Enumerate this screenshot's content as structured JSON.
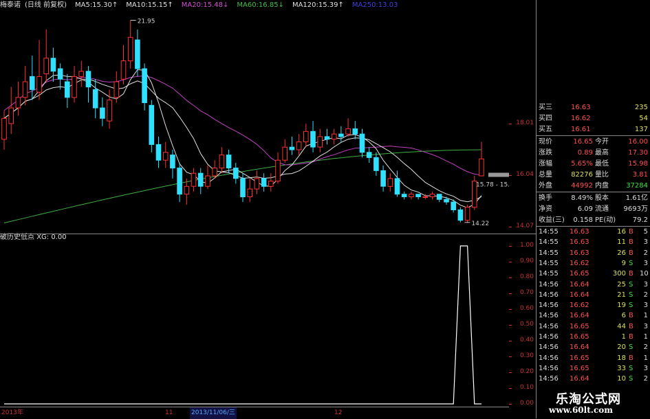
{
  "header": {
    "stock_name": "梅泰诺",
    "period": "(日线 前复权)",
    "mas": [
      {
        "label": "MA5:",
        "value": "15.30",
        "arrow": "↑",
        "color": "#e0e0e0"
      },
      {
        "label": "MA10:",
        "value": "15.15",
        "arrow": "↑",
        "color": "#e0e0e0"
      },
      {
        "label": "MA20:",
        "value": "15.48",
        "arrow": "↓",
        "color": "#d050d0"
      },
      {
        "label": "MA60:",
        "value": "16.85",
        "arrow": "↓",
        "color": "#40c040"
      },
      {
        "label": "MA120:",
        "value": "15.39",
        "arrow": "↑",
        "color": "#e0e0e0"
      },
      {
        "label": "MA250:",
        "value": "13.03",
        "arrow": "",
        "color": "#4040e0"
      }
    ]
  },
  "main_chart": {
    "price_ticks": [
      "18.01",
      "16.04",
      "14.07"
    ],
    "annotations": {
      "high": "21.95",
      "low": "14.22",
      "last_range": "15.78 - 15."
    },
    "colors": {
      "up": "#ff3030",
      "down": "#30e0ff",
      "ma5": "#e0e0e0",
      "ma10": "#e0e0e0",
      "ma20": "#c040c0",
      "ma60": "#40b040",
      "ma250": "#5050e0"
    }
  },
  "indicator": {
    "title": "破历史低点",
    "series_label": "XG: 0.00",
    "ticks": [
      "1.00",
      "0.90",
      "0.80",
      "0.70",
      "0.60",
      "0.50",
      "0.40",
      "0.30",
      "0.20",
      "0.10",
      "0.00"
    ],
    "values": [
      0,
      0,
      0,
      0,
      0,
      0,
      0,
      0,
      0,
      0,
      0,
      0,
      0,
      0,
      0,
      0,
      0,
      0,
      0,
      0,
      0,
      0,
      0,
      0,
      0,
      0,
      0,
      0,
      0,
      0,
      0,
      0,
      0,
      0,
      0,
      0,
      0,
      0,
      0,
      0,
      0,
      0,
      0,
      0,
      0,
      0,
      0,
      0,
      0,
      0,
      0,
      0,
      0,
      0,
      0,
      0,
      0,
      0,
      0,
      0,
      0,
      0,
      0,
      0,
      0,
      1,
      1,
      0,
      0
    ]
  },
  "x_axis": {
    "ticks": [
      {
        "label": "2013年",
        "selected": false
      },
      {
        "label": "11",
        "selected": false
      },
      {
        "label": "2013/11/06/三",
        "selected": true
      },
      {
        "label": "12",
        "selected": false
      }
    ]
  },
  "quote_panel": {
    "bids": [
      {
        "name": "买三",
        "price": "16.63",
        "vol": "235"
      },
      {
        "name": "买四",
        "price": "16.62",
        "vol": "54"
      },
      {
        "name": "买五",
        "price": "16.61",
        "vol": "137"
      }
    ],
    "stats": [
      {
        "l1": "现价",
        "v1": "16.65",
        "l2": "今开",
        "v2": "16.00",
        "c1": "#ff5050",
        "c2": "#ff5050"
      },
      {
        "l1": "涨跌",
        "v1": "0.89",
        "l2": "最高",
        "v2": "17.30",
        "c1": "#ff5050",
        "c2": "#ff5050"
      },
      {
        "l1": "涨幅",
        "v1": "5.65%",
        "l2": "最低",
        "v2": "15.98",
        "c1": "#ff5050",
        "c2": "#ff5050"
      },
      {
        "l1": "总量",
        "v1": "82276",
        "l2": "量比",
        "v2": "3.81",
        "c1": "#e0e060",
        "c2": "#ff5050"
      },
      {
        "l1": "外盘",
        "v1": "44992",
        "l2": "内盘",
        "v2": "37284",
        "c1": "#ff5050",
        "c2": "#40e040"
      }
    ],
    "stats2": [
      {
        "l1": "换手",
        "v1": "8.49%",
        "l2": "股本",
        "v2": "1.61亿"
      },
      {
        "l1": "净资",
        "v1": "6.09",
        "l2": "流通",
        "v2": "9693万"
      },
      {
        "l1": "收益(三)",
        "v1": "0.158",
        "l2": "PE(动)",
        "v2": "79.2"
      }
    ],
    "ticks": [
      {
        "t": "14:55",
        "p": "16.63",
        "v": "16",
        "bs": "B",
        "n": "5"
      },
      {
        "t": "14:55",
        "p": "16.63",
        "v": "11",
        "bs": "B",
        "n": "3"
      },
      {
        "t": "14:55",
        "p": "16.63",
        "v": "26",
        "bs": "B",
        "n": "2"
      },
      {
        "t": "14:55",
        "p": "16.62",
        "v": "9",
        "bs": "S",
        "n": "3"
      },
      {
        "t": "14:55",
        "p": "16.65",
        "v": "300",
        "bs": "B",
        "n": "10"
      },
      {
        "t": "14:56",
        "p": "16.64",
        "v": "25",
        "bs": "S",
        "n": "3"
      },
      {
        "t": "14:56",
        "p": "16.64",
        "v": "21",
        "bs": "S",
        "n": "2"
      },
      {
        "t": "14:56",
        "p": "16.62",
        "v": "19",
        "bs": "S",
        "n": "3"
      },
      {
        "t": "14:56",
        "p": "16.64",
        "v": "6",
        "bs": "B",
        "n": "1"
      },
      {
        "t": "14:56",
        "p": "16.65",
        "v": "44",
        "bs": "B",
        "n": "3"
      },
      {
        "t": "14:56",
        "p": "16.65",
        "v": "1",
        "bs": "B",
        "n": "1"
      },
      {
        "t": "14:56",
        "p": "16.64",
        "v": "20",
        "bs": "S",
        "n": "2"
      },
      {
        "t": "14:56",
        "p": "16.65",
        "v": "18",
        "bs": "B",
        "n": "1"
      },
      {
        "t": "14:56",
        "p": "16.65",
        "v": "33",
        "bs": "S",
        "n": "3"
      },
      {
        "t": "14:56",
        "p": "16.64",
        "v": "10",
        "bs": "S",
        "n": "2"
      }
    ]
  },
  "watermark": {
    "line1": "乐淘公式网",
    "line2": "www.60lt.com"
  }
}
